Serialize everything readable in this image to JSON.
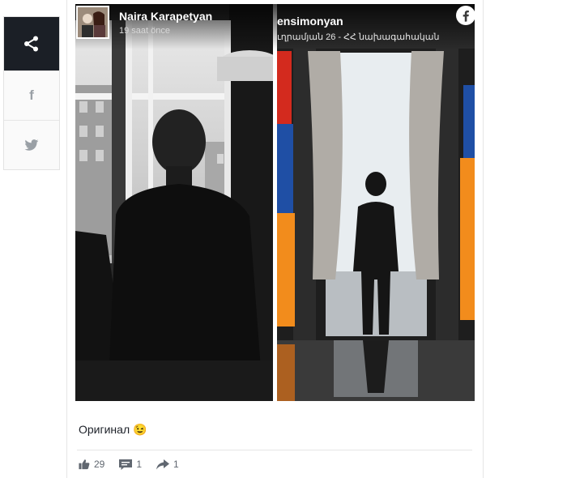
{
  "share": {
    "icons": [
      "share-icon",
      "facebook-icon",
      "twitter-icon"
    ],
    "facebook_glyph": "f"
  },
  "post": {
    "author": "Naira Karapetyan",
    "time": "19 saat önce",
    "right_image_overlay": {
      "name": "ensimonyan",
      "subtitle": "ւղրամյան 26 - ՀՀ նախագահական"
    },
    "caption": "Оригинал 😉",
    "stats": {
      "likes": "29",
      "comments": "1",
      "shares": "1"
    }
  },
  "colors": {
    "share_dark": "#1b1f26",
    "flag_red": "#d32a1e",
    "flag_blue": "#1f4fa5",
    "flag_orange": "#f28c1c"
  }
}
